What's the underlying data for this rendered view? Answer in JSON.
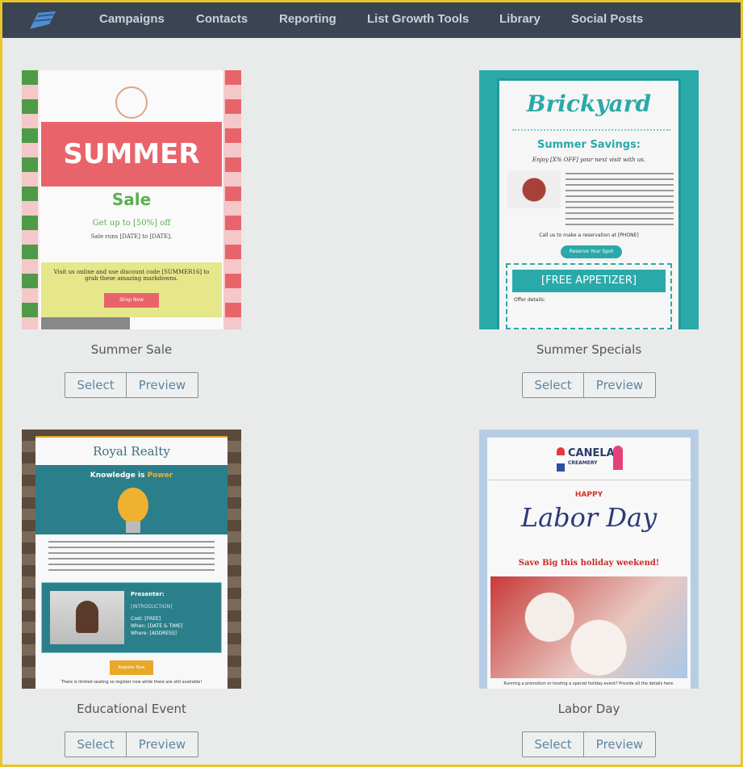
{
  "nav": {
    "items": [
      "Campaigns",
      "Contacts",
      "Reporting",
      "List Growth Tools",
      "Library",
      "Social Posts"
    ]
  },
  "buttons": {
    "select": "Select",
    "preview": "Preview"
  },
  "templates": [
    {
      "name": "Summer Sale",
      "headline": "SUMMER",
      "sub": "Sale",
      "offer": "Get up to [50%] off",
      "dates": "Sale runs [DATE] to [DATE].",
      "body": "Visit us online and use discount code [SUMMER16] to grab these amazing markdowns.",
      "cta": "Shop Now"
    },
    {
      "name": "Summer Specials",
      "brand": "Brickyard",
      "headline": "Summer Savings:",
      "offer": "Enjoy [X% OFF] your next visit with us.",
      "call": "Call us to make a reservation at [PHONE]",
      "cta": "Reserve Your Spot",
      "coupon": "[FREE APPETIZER]",
      "details": "Offer details:"
    },
    {
      "name": "Educational Event",
      "brand": "Royal Realty",
      "headline_a": "Knowledge is ",
      "headline_b": "Power",
      "presenter": "Presenter:",
      "intro": "[INTRODUCTION]",
      "cost": "Cost: [FREE]",
      "when": "When: [DATE & TIME]",
      "where": "Where: [ADDRESS]",
      "cta": "Register Now",
      "footer": "There is limited seating so register now while there are still available!"
    },
    {
      "name": "Labor Day",
      "brand": "CANELA",
      "brand_sub": "CREAMERY",
      "happy": "HAPPY",
      "headline": "Labor Day",
      "offer": "Save Big this holiday weekend!",
      "footer": "Running a promotion or hosting a special holiday event? Provide all the details here."
    }
  ],
  "colors": {
    "nav": "#3b4452",
    "border": "#e8c62a",
    "teal": "#2aa9a9",
    "coral": "#e8646a"
  }
}
